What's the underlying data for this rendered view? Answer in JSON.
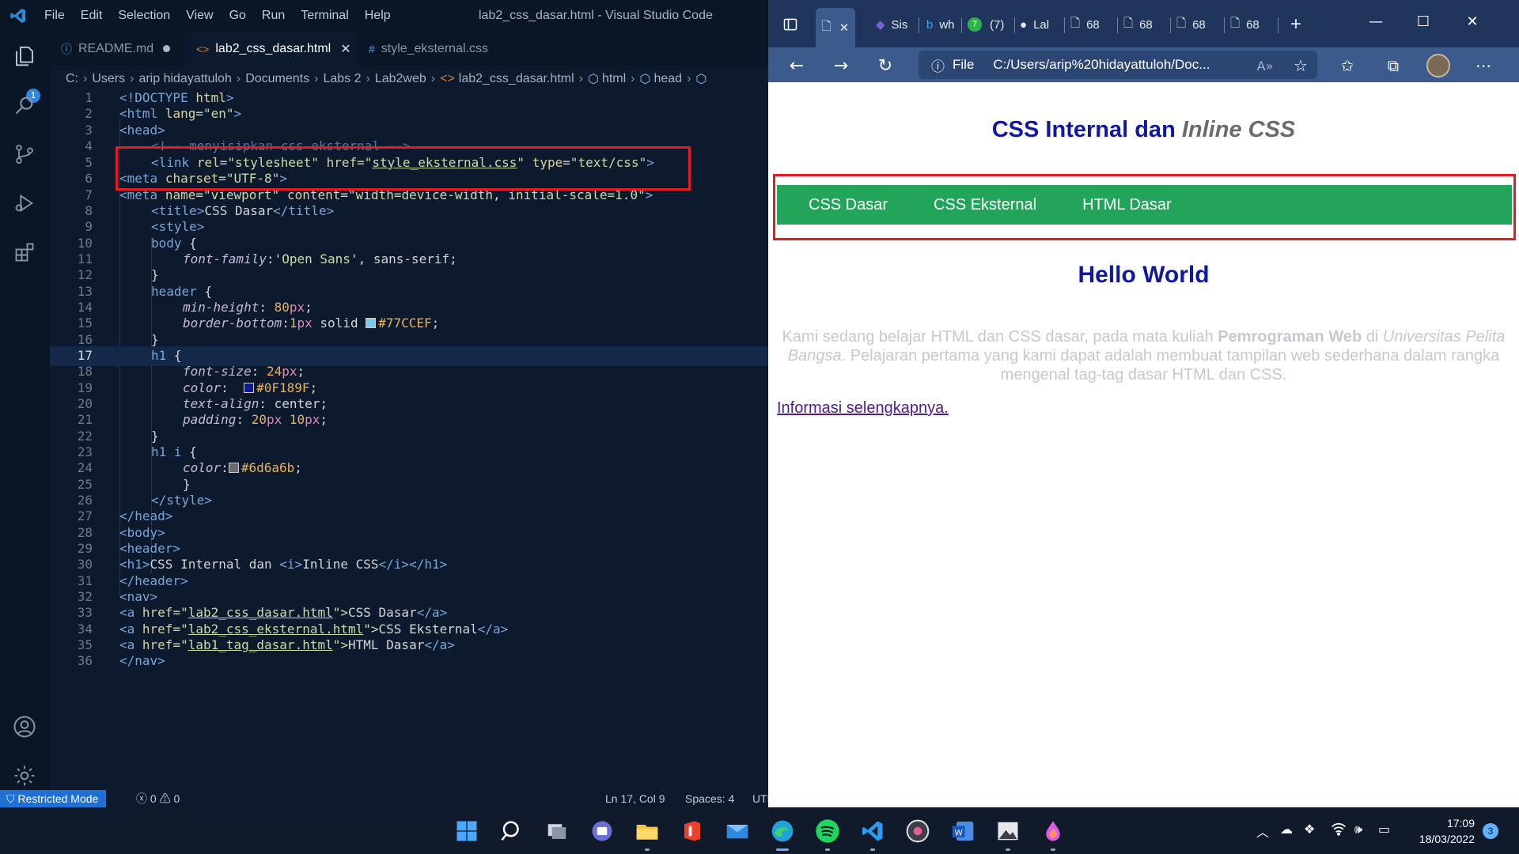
{
  "vscode": {
    "window_title": "lab2_css_dasar.html - Visual Studio Code",
    "menu": [
      "File",
      "Edit",
      "Selection",
      "View",
      "Go",
      "Run",
      "Terminal",
      "Help"
    ],
    "activity_badge": "1",
    "tabs": [
      {
        "label": "README.md",
        "state": "modified"
      },
      {
        "label": "lab2_css_dasar.html",
        "state": "active"
      },
      {
        "label": "style_eksternal.css",
        "state": "normal"
      }
    ],
    "breadcrumb": [
      "C:",
      "Users",
      "arip hidayattuloh",
      "Documents",
      "Labs 2",
      "Lab2web",
      "lab2_css_dasar.html",
      "html",
      "head"
    ],
    "line_numbers": [
      "1",
      "2",
      "3",
      "4",
      "5",
      "6",
      "7",
      "8",
      "9",
      "10",
      "11",
      "12",
      "13",
      "14",
      "15",
      "16",
      "17",
      "18",
      "19",
      "20",
      "21",
      "22",
      "23",
      "24",
      "25",
      "26",
      "27",
      "28",
      "29",
      "30",
      "31",
      "32",
      "33",
      "34",
      "35",
      "36"
    ],
    "code": {
      "l1": [
        "<!DOCTYPE",
        "html",
        ">"
      ],
      "l2": [
        "<html",
        "lang",
        "=",
        "\"en\"",
        ">"
      ],
      "l3": [
        "<head>"
      ],
      "l4": [
        "<!-- menyisipkan css eksternal -->"
      ],
      "l5": [
        "<link",
        "rel",
        "=",
        "\"stylesheet\"",
        "href",
        "=\"",
        "style_eksternal.css",
        "\"",
        "type",
        "=",
        "\"text/css\"",
        ">"
      ],
      "l6": [
        "<meta",
        "charset",
        "=",
        "\"UTF-8\"",
        ">"
      ],
      "l7": [
        "<meta",
        "name",
        "=",
        "\"viewport\"",
        "content",
        "=",
        "\"width=device-width, initial-scale=1.0\"",
        ">"
      ],
      "l8": [
        "<title>",
        "CSS Dasar",
        "</title>"
      ],
      "l9": [
        "<style>"
      ],
      "l10": [
        "body",
        "{"
      ],
      "l11": [
        "font-family",
        ":",
        "'Open Sans'",
        ", sans-serif;"
      ],
      "l12": [
        "}"
      ],
      "l13": [
        "header",
        "{"
      ],
      "l14": [
        "min-height",
        ": ",
        "80",
        "px",
        ";"
      ],
      "l15": [
        "border-bottom",
        ":",
        "1",
        "px",
        " solid ",
        "#77CCEF",
        ";"
      ],
      "l16": [
        "}"
      ],
      "l17": [
        "h1",
        "{"
      ],
      "l18": [
        "font-size",
        ": ",
        "24",
        "px",
        ";"
      ],
      "l19": [
        "color",
        ":  ",
        "#0F189F",
        ";"
      ],
      "l20": [
        "text-align",
        ": center;"
      ],
      "l21": [
        "padding",
        ": ",
        "20",
        "px ",
        "10",
        "px",
        ";"
      ],
      "l22": [
        "}"
      ],
      "l23": [
        "h1 i",
        "{"
      ],
      "l24": [
        "color",
        ":",
        "#6d6a6b",
        ";"
      ],
      "l25": [
        "}"
      ],
      "l26": [
        "</style>"
      ],
      "l27": [
        "</head>"
      ],
      "l28": [
        "<body>"
      ],
      "l29": [
        "<header>"
      ],
      "l30": [
        "<h1>",
        "CSS Internal dan ",
        "<i>",
        "Inline CSS",
        "</i></h1>"
      ],
      "l31": [
        "</header>"
      ],
      "l32": [
        "<nav>"
      ],
      "l33": [
        "<a",
        "href",
        "=\"",
        "lab2_css_dasar.html",
        "\">",
        "CSS Dasar",
        "</a>"
      ],
      "l34": [
        "<a",
        "href",
        "=\"",
        "lab2_css_eksternal.html",
        "\">",
        "CSS Eksternal",
        "</a>"
      ],
      "l35": [
        "<a",
        "href",
        "=\"",
        "lab1_tag_dasar.html",
        "\">",
        "HTML Dasar",
        "</a>"
      ],
      "l36": [
        "</nav>"
      ]
    },
    "swatches": {
      "border": "#77CCEF",
      "h1": "#0F189F",
      "h1i": "#6d6a6b"
    },
    "status": {
      "mode": "Restricted Mode",
      "errors": "0",
      "warnings": "0",
      "position": "Ln 17, Col 9",
      "spaces": "Spaces: 4",
      "encoding": "UTF"
    }
  },
  "edge": {
    "tabs": [
      "Sis",
      "wh",
      "(7)",
      "Lal",
      "68",
      "68",
      "68",
      "68"
    ],
    "address": {
      "scheme": "File",
      "url": "C:/Users/arip%20hidayattuloh/Doc..."
    }
  },
  "page": {
    "h1_text": "CSS Internal dan ",
    "h1_italic": "Inline CSS",
    "nav": [
      "CSS Dasar",
      "CSS Eksternal",
      "HTML Dasar"
    ],
    "h2": "Hello World",
    "p_part1": "Kami sedang belajar HTML dan CSS dasar, pada mata kuliah ",
    "p_bold": "Pemrograman Web",
    "p_part2": " di ",
    "p_italic": "Universitas Pelita Bangsa",
    "p_part3": ". Pelajaran pertama yang kami dapat adalah membuat tampilan web sederhana dalam rangka mengenal tag-tag dasar HTML dan CSS.",
    "more_link": "Informasi selengkapnya.",
    "colors": {
      "heading": "#0F189F",
      "italic": "#6d6a6b",
      "nav_bg": "#22a55b",
      "highlight": "#e31b23"
    }
  },
  "taskbar": {
    "time": "17:09",
    "date": "18/03/2022",
    "notification_count": "3"
  }
}
